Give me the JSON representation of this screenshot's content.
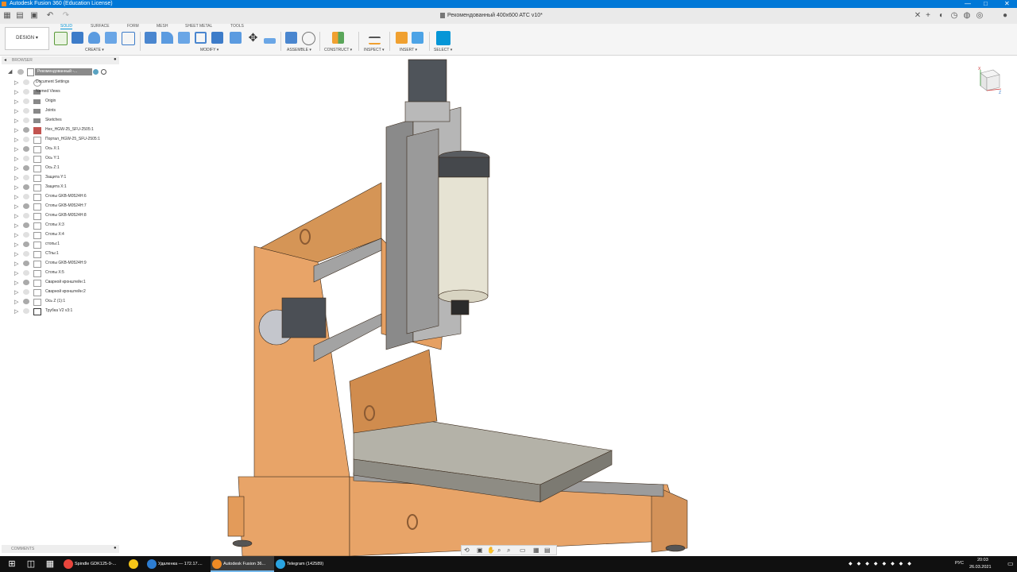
{
  "window": {
    "title": "Autodesk Fusion 360 (Education License)",
    "minimize": "—",
    "maximize": "□",
    "close": "✕"
  },
  "document_tab": {
    "title": "Рекомендованный 400x600 ATC v10*"
  },
  "ribbon": {
    "workspace": "DESIGN",
    "tabs": [
      "SOLID",
      "SURFACE",
      "FORM",
      "MESH",
      "SHEET METAL",
      "TOOLS"
    ],
    "active_tab": "SOLID",
    "groups": [
      "CREATE",
      "MODIFY",
      "ASSEMBLE",
      "CONSTRUCT",
      "INSPECT",
      "INSERT",
      "SELECT"
    ]
  },
  "browser": {
    "header": "BROWSER",
    "root": "Рекомендованный -...",
    "items": [
      {
        "label": "Document Settings",
        "type": "gear"
      },
      {
        "label": "Named Views",
        "type": "folder"
      },
      {
        "label": "Origin",
        "type": "folder"
      },
      {
        "label": "Joints",
        "type": "folder"
      },
      {
        "label": "Sketches",
        "type": "folder"
      },
      {
        "label": "Hex_HGW-25_SFU-2505:1",
        "type": "component"
      },
      {
        "label": "Портал_HGW-25_SFU-2505:1",
        "type": "component"
      },
      {
        "label": "Ось X:1",
        "type": "component"
      },
      {
        "label": "Ось Y:1",
        "type": "component"
      },
      {
        "label": "Ось Z:1",
        "type": "component"
      },
      {
        "label": "Защита Y:1",
        "type": "component"
      },
      {
        "label": "Защита X:1",
        "type": "component"
      },
      {
        "label": "Стопы GKB-M0524H:6",
        "type": "component"
      },
      {
        "label": "Стопы GKB-M0524H:7",
        "type": "component"
      },
      {
        "label": "Стопы GKB-M0524H:8",
        "type": "component"
      },
      {
        "label": "Стопы X:3",
        "type": "component"
      },
      {
        "label": "Стопы X:4",
        "type": "component"
      },
      {
        "label": "стопы:1",
        "type": "component"
      },
      {
        "label": "СТпы:1",
        "type": "component"
      },
      {
        "label": "Стопы GKB-M0524H:9",
        "type": "component"
      },
      {
        "label": "Стопы X:5",
        "type": "component"
      },
      {
        "label": "Сварной кронштейн:1",
        "type": "component"
      },
      {
        "label": "Сварной кронштейн:2",
        "type": "component"
      },
      {
        "label": "Ось Z (1):1",
        "type": "component"
      },
      {
        "label": "Трубка V2 v3:1",
        "type": "link"
      }
    ]
  },
  "comments": {
    "header": "COMMENTS"
  },
  "viewcube": {
    "axis_z": "Z",
    "axis_x": "X"
  },
  "taskbar": {
    "apps": [
      {
        "label": "Spindle GDK125-9-...",
        "color": "#e8453c"
      },
      {
        "label": "",
        "color": "#f5c518"
      },
      {
        "label": "Удаленка — 172.17....",
        "color": "#2d7dd2"
      },
      {
        "label": "Autodesk Fusion 36...",
        "color": "#f08a24",
        "active": true
      },
      {
        "label": "Telegram (142589)",
        "color": "#2aa3e0"
      }
    ],
    "lang": "РУС",
    "time": "20:03",
    "date": "26.03.2021"
  },
  "colors": {
    "titlebar": "#0078d7",
    "frame": "#e8a468",
    "frame_dark": "#c98750",
    "steel": "#8f8f8f",
    "table": "#a8a8a0",
    "spindle": "#e6e3d3"
  }
}
